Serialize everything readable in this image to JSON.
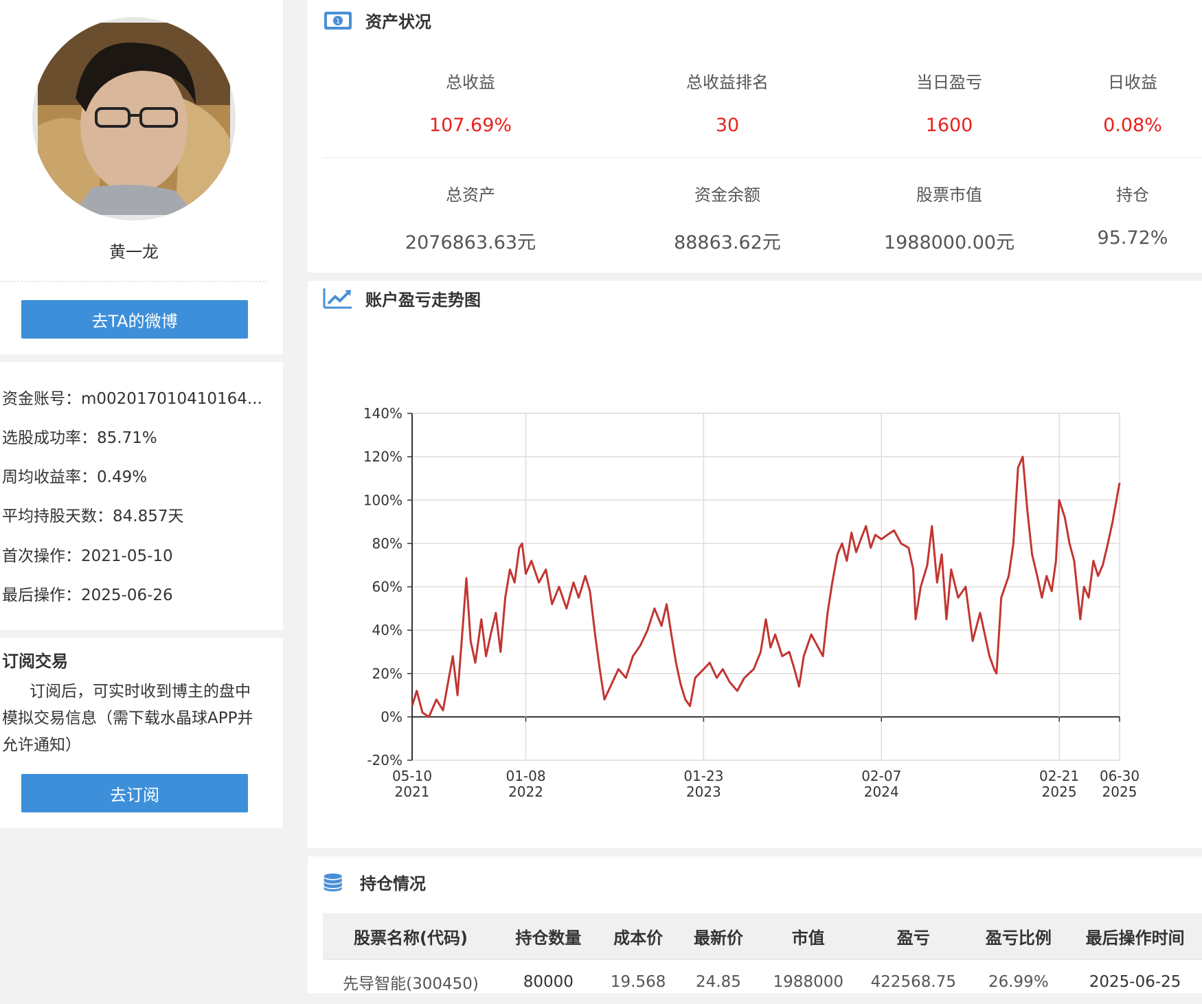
{
  "profile": {
    "name": "黄一龙",
    "weibo_button": "去TA的微博"
  },
  "stats": [
    {
      "label": "资金账号：",
      "value": "m002017010410164..."
    },
    {
      "label": "选股成功率：",
      "value": "85.71%"
    },
    {
      "label": "周均收益率：",
      "value": "0.49%"
    },
    {
      "label": "平均持股天数：",
      "value": "84.857天"
    },
    {
      "label": "首次操作：",
      "value": "2021-05-10"
    },
    {
      "label": "最后操作：",
      "value": "2025-06-26"
    }
  ],
  "subscribe": {
    "title": "订阅交易",
    "desc": "订阅后，可实时收到博主的盘中模拟交易信息（需下载水晶球APP并允许通知）",
    "button": "去订阅"
  },
  "assets": {
    "title": "资产状况",
    "row1": [
      {
        "label": "总收益",
        "value": "107.69%"
      },
      {
        "label": "总收益排名",
        "value": "30"
      },
      {
        "label": "当日盈亏",
        "value": "1600"
      },
      {
        "label": "日收益",
        "value": "0.08%"
      }
    ],
    "row2": [
      {
        "label": "总资产",
        "value": "2076863.63元"
      },
      {
        "label": "资金余额",
        "value": "88863.62元"
      },
      {
        "label": "股票市值",
        "value": "1988000.00元"
      },
      {
        "label": "持仓",
        "value": "95.72%"
      }
    ]
  },
  "chart_section": {
    "title": "账户盈亏走势图"
  },
  "chart_data": {
    "type": "line",
    "title": "",
    "xlabel": "",
    "ylabel": "",
    "ylim": [
      -20,
      140
    ],
    "yticks": [
      "140%",
      "120%",
      "100%",
      "80%",
      "60%",
      "40%",
      "20%",
      "0%",
      "-20%"
    ],
    "xticks": [
      {
        "date": "05-10",
        "year": "2021"
      },
      {
        "date": "01-08",
        "year": "2022"
      },
      {
        "date": "01-23",
        "year": "2023"
      },
      {
        "date": "02-07",
        "year": "2024"
      },
      {
        "date": "02-21",
        "year": "2025"
      },
      {
        "date": "06-30",
        "year": "2025"
      }
    ],
    "grid": true,
    "line_color": "#c23531",
    "series": [
      {
        "values": [
          [
            "2021-05-10",
            5
          ],
          [
            "2021-05-20",
            12
          ],
          [
            "2021-06-01",
            2
          ],
          [
            "2021-06-15",
            0
          ],
          [
            "2021-07-01",
            8
          ],
          [
            "2021-07-15",
            3
          ],
          [
            "2021-07-25",
            15
          ],
          [
            "2021-08-05",
            28
          ],
          [
            "2021-08-15",
            10
          ],
          [
            "2021-08-25",
            38
          ],
          [
            "2021-09-03",
            64
          ],
          [
            "2021-09-12",
            35
          ],
          [
            "2021-09-22",
            25
          ],
          [
            "2021-10-05",
            45
          ],
          [
            "2021-10-15",
            28
          ],
          [
            "2021-10-25",
            38
          ],
          [
            "2021-11-05",
            48
          ],
          [
            "2021-11-15",
            30
          ],
          [
            "2021-11-25",
            55
          ],
          [
            "2021-12-05",
            68
          ],
          [
            "2021-12-15",
            62
          ],
          [
            "2021-12-25",
            78
          ],
          [
            "2021-12-31",
            80
          ],
          [
            "2022-01-08",
            66
          ],
          [
            "2022-01-20",
            72
          ],
          [
            "2022-02-05",
            62
          ],
          [
            "2022-02-20",
            68
          ],
          [
            "2022-03-05",
            52
          ],
          [
            "2022-03-20",
            60
          ],
          [
            "2022-04-05",
            50
          ],
          [
            "2022-04-20",
            62
          ],
          [
            "2022-05-01",
            55
          ],
          [
            "2022-05-15",
            65
          ],
          [
            "2022-05-25",
            58
          ],
          [
            "2022-06-05",
            38
          ],
          [
            "2022-06-15",
            22
          ],
          [
            "2022-06-25",
            8
          ],
          [
            "2022-07-10",
            15
          ],
          [
            "2022-07-25",
            22
          ],
          [
            "2022-08-10",
            18
          ],
          [
            "2022-08-25",
            28
          ],
          [
            "2022-09-10",
            33
          ],
          [
            "2022-09-25",
            40
          ],
          [
            "2022-10-10",
            50
          ],
          [
            "2022-10-25",
            42
          ],
          [
            "2022-11-05",
            52
          ],
          [
            "2022-11-15",
            38
          ],
          [
            "2022-11-25",
            25
          ],
          [
            "2022-12-05",
            15
          ],
          [
            "2022-12-15",
            8
          ],
          [
            "2022-12-25",
            5
          ],
          [
            "2023-01-05",
            18
          ],
          [
            "2023-01-23",
            22
          ],
          [
            "2023-02-05",
            25
          ],
          [
            "2023-02-20",
            18
          ],
          [
            "2023-03-05",
            22
          ],
          [
            "2023-03-20",
            16
          ],
          [
            "2023-04-05",
            12
          ],
          [
            "2023-04-20",
            18
          ],
          [
            "2023-05-10",
            22
          ],
          [
            "2023-05-25",
            30
          ],
          [
            "2023-06-05",
            45
          ],
          [
            "2023-06-15",
            32
          ],
          [
            "2023-06-25",
            38
          ],
          [
            "2023-07-10",
            28
          ],
          [
            "2023-07-25",
            30
          ],
          [
            "2023-08-05",
            22
          ],
          [
            "2023-08-15",
            14
          ],
          [
            "2023-08-25",
            28
          ],
          [
            "2023-09-10",
            38
          ],
          [
            "2023-09-20",
            34
          ],
          [
            "2023-10-05",
            28
          ],
          [
            "2023-10-15",
            48
          ],
          [
            "2023-10-25",
            62
          ],
          [
            "2023-11-05",
            75
          ],
          [
            "2023-11-15",
            80
          ],
          [
            "2023-11-25",
            72
          ],
          [
            "2023-12-05",
            85
          ],
          [
            "2023-12-15",
            76
          ],
          [
            "2023-12-25",
            82
          ],
          [
            "2024-01-05",
            88
          ],
          [
            "2024-01-15",
            78
          ],
          [
            "2024-01-25",
            84
          ],
          [
            "2024-02-07",
            82
          ],
          [
            "2024-02-20",
            84
          ],
          [
            "2024-03-05",
            86
          ],
          [
            "2024-03-20",
            80
          ],
          [
            "2024-04-05",
            78
          ],
          [
            "2024-04-15",
            68
          ],
          [
            "2024-04-20",
            45
          ],
          [
            "2024-05-01",
            60
          ],
          [
            "2024-05-15",
            70
          ],
          [
            "2024-05-25",
            88
          ],
          [
            "2024-06-05",
            62
          ],
          [
            "2024-06-15",
            75
          ],
          [
            "2024-06-25",
            45
          ],
          [
            "2024-07-05",
            68
          ],
          [
            "2024-07-20",
            55
          ],
          [
            "2024-08-05",
            60
          ],
          [
            "2024-08-20",
            35
          ],
          [
            "2024-09-05",
            48
          ],
          [
            "2024-09-15",
            38
          ],
          [
            "2024-09-25",
            28
          ],
          [
            "2024-10-05",
            22
          ],
          [
            "2024-10-10",
            20
          ],
          [
            "2024-10-20",
            55
          ],
          [
            "2024-11-05",
            65
          ],
          [
            "2024-11-15",
            80
          ],
          [
            "2024-11-25",
            115
          ],
          [
            "2024-12-05",
            120
          ],
          [
            "2024-12-15",
            95
          ],
          [
            "2024-12-25",
            75
          ],
          [
            "2025-01-05",
            65
          ],
          [
            "2025-01-15",
            55
          ],
          [
            "2025-01-25",
            65
          ],
          [
            "2025-02-05",
            58
          ],
          [
            "2025-02-14",
            72
          ],
          [
            "2025-02-21",
            100
          ],
          [
            "2025-03-05",
            92
          ],
          [
            "2025-03-15",
            80
          ],
          [
            "2025-03-25",
            72
          ],
          [
            "2025-04-07",
            45
          ],
          [
            "2025-04-15",
            60
          ],
          [
            "2025-04-25",
            55
          ],
          [
            "2025-05-05",
            72
          ],
          [
            "2025-05-15",
            65
          ],
          [
            "2025-05-25",
            70
          ],
          [
            "2025-06-05",
            80
          ],
          [
            "2025-06-15",
            90
          ],
          [
            "2025-06-25",
            102
          ],
          [
            "2025-06-30",
            108
          ]
        ]
      }
    ]
  },
  "holdings": {
    "title": "持仓情况",
    "columns": [
      "股票名称(代码)",
      "持仓数量",
      "成本价",
      "最新价",
      "市值",
      "盈亏",
      "盈亏比例",
      "最后操作时间"
    ],
    "rows": [
      [
        "先导智能(300450)",
        "80000",
        "19.568",
        "24.85",
        "1988000",
        "422568.75",
        "26.99%",
        "2025-06-25"
      ]
    ]
  },
  "colors": {
    "accent": "#3d8fda",
    "positive": "#e8211d",
    "stock_link": "#9a6a0a",
    "chart_line": "#c23531"
  }
}
